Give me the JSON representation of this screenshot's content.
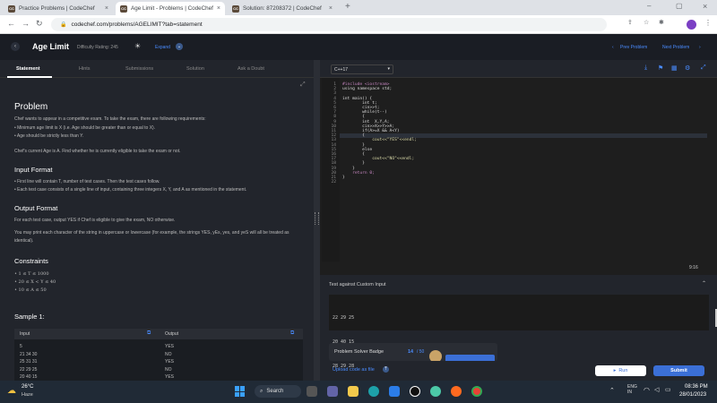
{
  "browser": {
    "tabs": [
      {
        "label": "Practice Problems | CodeChef",
        "favicon": "CC"
      },
      {
        "label": "Age Limit - Problems | CodeChef",
        "favicon": "CC"
      },
      {
        "label": "Solution: 87208372 | CodeChef",
        "favicon": "CC"
      }
    ],
    "url": "codechef.com/problems/AGELIMIT?tab=statement"
  },
  "header": {
    "title": "Age Limit",
    "difficulty": "Difficulty Rating: 245",
    "expand": "Expand",
    "prev": "Prev Problem",
    "next": "Next Problem"
  },
  "subtabs": [
    "Statement",
    "Hints",
    "Submissions",
    "Solution",
    "Ask a Doubt"
  ],
  "problem": {
    "heading": "Problem",
    "intro": "Chef wants to appear in a competitive exam. To take the exam, there are following requirements:",
    "req1": "Minimum age limit is X (i.e. Age should be greater than or equal to X).",
    "req2": "Age should be strictly less than Y.",
    "current": "Chef's current Age is A. Find whether he is currently eligible to take the exam or not.",
    "input_heading": "Input Format",
    "input1": "First line will contain T, number of test cases. Then the test cases follow.",
    "input2": "Each test case consists of a single line of input, containing three integers X, Y, and A as mentioned in the statement.",
    "output_heading": "Output Format",
    "output1": "For each test case, output YES if Chef is eligible to give the exam, NO otherwise.",
    "output2": "You may print each character of the string in uppercase or lowercase (for example, the strings YES, yEs, yes, and yeS will all be treated as identical).",
    "constraints_heading": "Constraints",
    "c1": "1 ≤ T ≤ 1000",
    "c2": "20 ≤ X < Y ≤ 40",
    "c3": "10 ≤ A ≤ 50",
    "sample_heading": "Sample 1:",
    "sample_input_label": "Input",
    "sample_output_label": "Output",
    "sample_rows": [
      {
        "in": "5",
        "out": "YES"
      },
      {
        "in": "21 34 30",
        "out": "NO"
      },
      {
        "in": "25 31 31",
        "out": "YES"
      },
      {
        "in": "22 29 25",
        "out": "NO"
      },
      {
        "in": "20 40 15",
        "out": "YES"
      }
    ]
  },
  "editor": {
    "language": "C++17",
    "lines": [
      "#include <iostream>",
      "using namespace std;",
      "",
      "int main() {",
      "        int t;",
      "        cin>>t;",
      "        while(t--)",
      "        {",
      "        int  X,Y,A;",
      "        cin>>X>>Y>>A;",
      "        if(A>=X && A<Y)",
      "        {",
      "            cout<<\"YES\"<<endl;",
      "        }",
      "        else",
      "        {",
      "            cout<<\"NO\"<<endl;",
      "        }",
      "    }",
      "    return 0;",
      "}",
      ""
    ],
    "cursor": "9:16"
  },
  "custom": {
    "label": "Test against Custom Input",
    "lines": [
      "22 29 25",
      "20 40 15",
      "28 29 28"
    ],
    "badge_title": "Problem Solver Badge",
    "badge_count": "14",
    "badge_total": "/ 50",
    "upload": "Upload code as file",
    "run": "Run",
    "submit": "Submit"
  },
  "taskbar": {
    "temp": "26°C",
    "weather": "Haze",
    "search": "Search",
    "lang": "ENG\nIN",
    "time": "08:36 PM",
    "date": "28/01/2023"
  }
}
